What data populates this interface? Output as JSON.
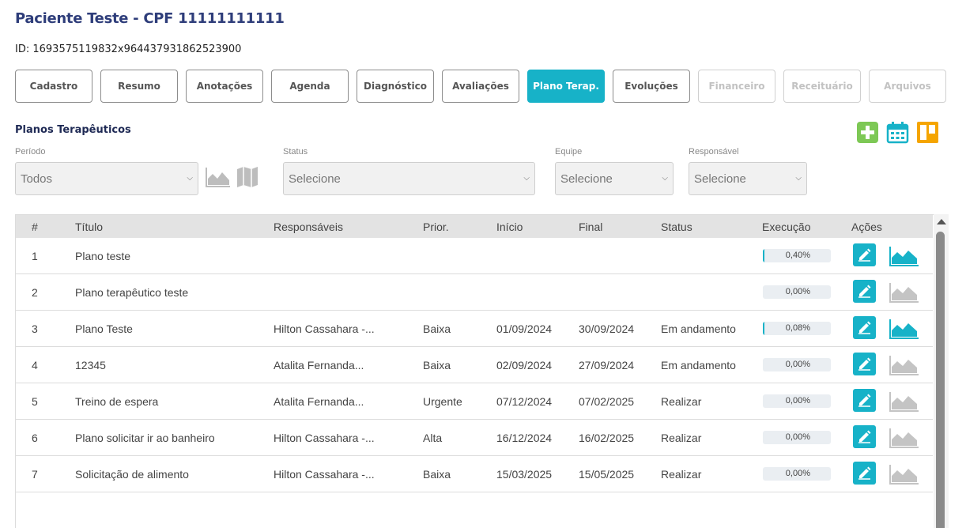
{
  "patient": {
    "title": "Paciente Teste - CPF 11111111111",
    "id_line": "ID: 1693575119832x964437931862523900"
  },
  "tabs": [
    {
      "label": "Cadastro",
      "state": "normal"
    },
    {
      "label": "Resumo",
      "state": "normal"
    },
    {
      "label": "Anotações",
      "state": "normal"
    },
    {
      "label": "Agenda",
      "state": "normal"
    },
    {
      "label": "Diagnóstico",
      "state": "normal"
    },
    {
      "label": "Avaliações",
      "state": "normal"
    },
    {
      "label": "Plano Terap.",
      "state": "active"
    },
    {
      "label": "Evoluções",
      "state": "normal"
    },
    {
      "label": "Financeiro",
      "state": "disabled"
    },
    {
      "label": "Receituário",
      "state": "disabled"
    },
    {
      "label": "Arquivos",
      "state": "disabled"
    }
  ],
  "section": {
    "title": "Planos Terapêuticos",
    "actions": [
      "add-icon",
      "calendar-icon",
      "board-icon"
    ],
    "colors": {
      "add": "#7dc855",
      "calendar": "#17b2c8",
      "board": "#f5a500"
    }
  },
  "filters": {
    "period": {
      "label": "Período",
      "value": "Todos"
    },
    "status": {
      "label": "Status",
      "value": "Selecione"
    },
    "team": {
      "label": "Equipe",
      "value": "Selecione"
    },
    "responsible": {
      "label": "Responsável",
      "value": "Selecione"
    }
  },
  "table": {
    "headers": [
      "#",
      "Título",
      "Responsáveis",
      "Prior.",
      "Início",
      "Final",
      "Status",
      "Execução",
      "Ações"
    ],
    "rows": [
      {
        "num": "1",
        "title": "Plano teste",
        "resp": "",
        "prior": "",
        "start": "",
        "end": "",
        "status": "",
        "exec": "0,40%",
        "progress": 0.004,
        "chart_active": true
      },
      {
        "num": "2",
        "title": "Plano terapêutico teste",
        "resp": "",
        "prior": "",
        "start": "",
        "end": "",
        "status": "",
        "exec": "0,00%",
        "progress": 0.0,
        "chart_active": false
      },
      {
        "num": "3",
        "title": "Plano Teste",
        "resp": "Hilton Cassahara -...",
        "prior": "Baixa",
        "start": "01/09/2024",
        "end": "30/09/2024",
        "status": "Em andamento",
        "exec": "0,08%",
        "progress": 0.0008,
        "chart_active": true
      },
      {
        "num": "4",
        "title": "12345",
        "resp": "Atalita Fernanda...",
        "prior": "Baixa",
        "start": "02/09/2024",
        "end": "27/09/2024",
        "status": "Em andamento",
        "exec": "0,00%",
        "progress": 0.0,
        "chart_active": false
      },
      {
        "num": "5",
        "title": "Treino de espera",
        "resp": "Atalita Fernanda...",
        "prior": "Urgente",
        "start": "07/12/2024",
        "end": "07/02/2025",
        "status": "Realizar",
        "exec": "0,00%",
        "progress": 0.0,
        "chart_active": false
      },
      {
        "num": "6",
        "title": "Plano solicitar ir ao banheiro",
        "resp": "Hilton Cassahara -...",
        "prior": "Alta",
        "start": "16/12/2024",
        "end": "16/02/2025",
        "status": "Realizar",
        "exec": "0,00%",
        "progress": 0.0,
        "chart_active": false
      },
      {
        "num": "7",
        "title": "Solicitação de alimento",
        "resp": "Hilton Cassahara -...",
        "prior": "Baixa",
        "start": "15/03/2025",
        "end": "15/05/2025",
        "status": "Realizar",
        "exec": "0,00%",
        "progress": 0.0,
        "chart_active": false
      }
    ]
  },
  "colors": {
    "accent": "#17b2c8",
    "chart_inactive": "#c4c4c4"
  }
}
